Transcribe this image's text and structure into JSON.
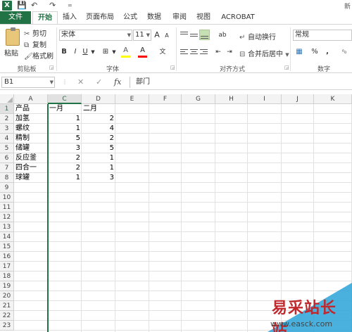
{
  "title_bar": {
    "app_icon": "X",
    "save_icon": "💾",
    "undo_icon": "↶",
    "redo_icon": "↷",
    "customize_icon": "=",
    "right_text": "新"
  },
  "tabs": {
    "file": "文件",
    "items": [
      "开始",
      "插入",
      "页面布局",
      "公式",
      "数据",
      "审阅",
      "视图",
      "ACROBAT"
    ],
    "active_index": 0
  },
  "ribbon": {
    "clipboard": {
      "paste": "粘贴",
      "cut": "剪切",
      "copy": "复制",
      "format_painter": "格式刷",
      "group_label": "剪贴板"
    },
    "font": {
      "font_name": "宋体",
      "font_size": "11",
      "grow_font": "A",
      "shrink_font": "A",
      "bold": "B",
      "italic": "I",
      "underline": "U",
      "border_icon": "⊞",
      "fill_color_icon": "A",
      "font_color_icon": "A",
      "phonetic_icon": "文",
      "group_label": "字体",
      "fill_color": "#ffff00",
      "font_color": "#ff0000"
    },
    "alignment": {
      "orientation_icon": "ab",
      "wrap_text": "自动换行",
      "merge_center": "合并后居中",
      "group_label": "对齐方式"
    },
    "number": {
      "format": "常规",
      "percent": "%",
      "comma": ",",
      "group_label": "数字"
    }
  },
  "formula_bar": {
    "name_box": "B1",
    "cancel_icon": "✕",
    "enter_icon": "✓",
    "fx": "fx",
    "formula": "部门"
  },
  "sheet": {
    "columns": [
      "A",
      "C",
      "D",
      "E",
      "F",
      "G",
      "H",
      "I",
      "J",
      "K"
    ],
    "rows": [
      "1",
      "2",
      "3",
      "4",
      "5",
      "6",
      "7",
      "8",
      "9",
      "10",
      "11",
      "12",
      "13",
      "14",
      "15",
      "16",
      "17",
      "18",
      "19",
      "20",
      "21",
      "22",
      "23"
    ],
    "header_row": [
      "产品",
      "一月",
      "二月"
    ],
    "data": [
      [
        "加氢",
        "1",
        "2"
      ],
      [
        "螺纹",
        "1",
        "4"
      ],
      [
        "精制",
        "5",
        "2"
      ],
      [
        "储罐",
        "3",
        "5"
      ],
      [
        "反应釜",
        "2",
        "1"
      ],
      [
        "四合一",
        "2",
        "1"
      ],
      [
        "球罐",
        "1",
        "3"
      ]
    ],
    "accent": "#217346"
  },
  "watermark": {
    "text": "易采站长站",
    "url": "www.easck.com",
    "triangle_color": "#2aa3d8",
    "text_color": "#c0282d"
  }
}
